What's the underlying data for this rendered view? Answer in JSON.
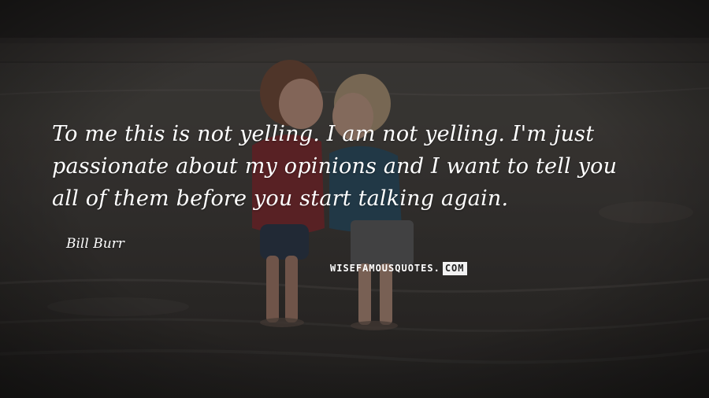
{
  "quote": {
    "lines": [
      "To me this is not yelling. I am not yelling. I'm just",
      "passionate about my opinions and I want to tell you",
      "all of them before you start talking again."
    ]
  },
  "author": "Bill Burr",
  "watermark": {
    "main": "WISEFAMOUSQUOTES.",
    "boxed": "COM"
  }
}
